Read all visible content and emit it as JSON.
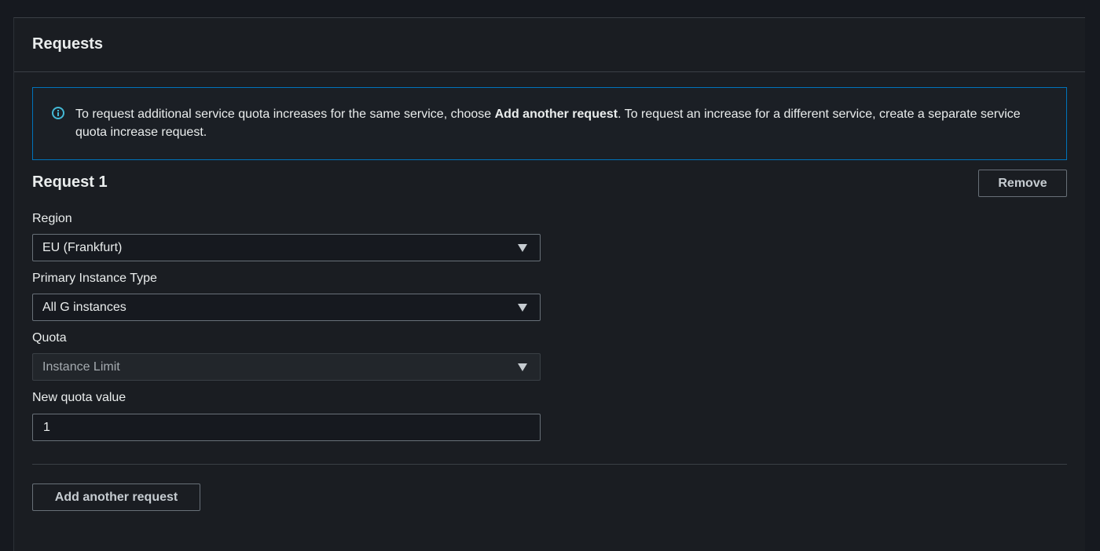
{
  "panel": {
    "title": "Requests"
  },
  "info": {
    "icon": "info-icon",
    "text_before": "To request additional service quota increases for the same service, choose ",
    "text_bold": "Add another request",
    "text_after": ". To request an increase for a different service, create a separate service quota increase request.",
    "border_color": "#0073bb"
  },
  "request": {
    "title": "Request 1",
    "remove_label": "Remove",
    "fields": {
      "region": {
        "label": "Region",
        "value": "EU (Frankfurt)"
      },
      "instance_type": {
        "label": "Primary Instance Type",
        "value": "All G instances"
      },
      "quota": {
        "label": "Quota",
        "value": "Instance Limit"
      },
      "new_quota": {
        "label": "New quota value",
        "value": "1"
      }
    }
  },
  "footer": {
    "add_label": "Add another request"
  }
}
